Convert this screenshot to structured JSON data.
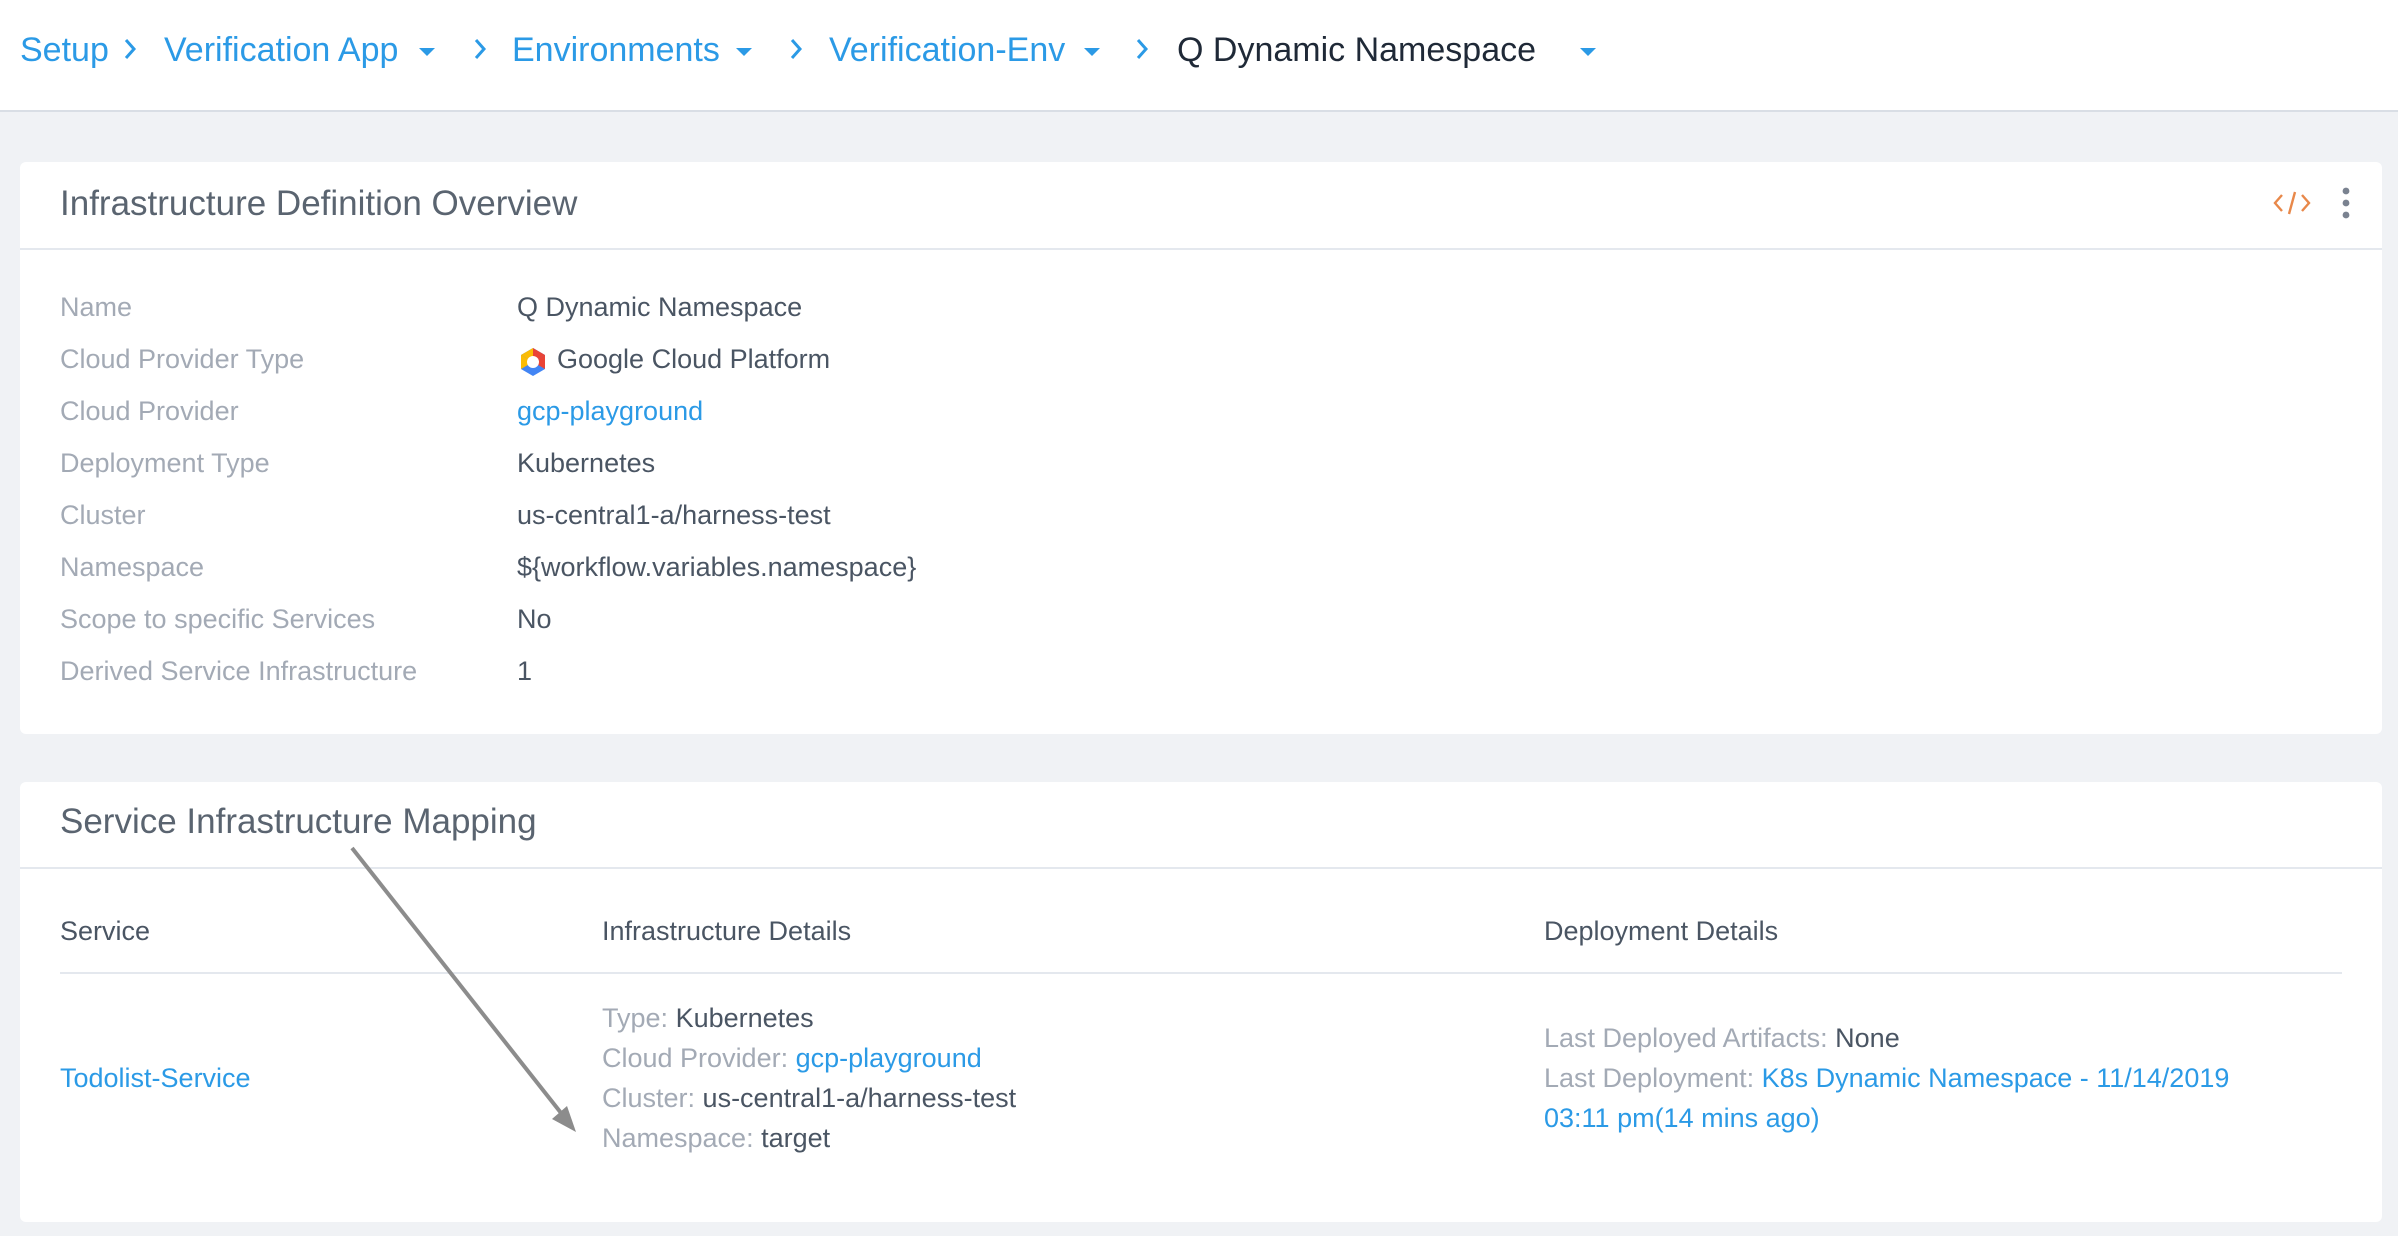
{
  "breadcrumb": [
    {
      "label": "Setup",
      "has_dropdown": false
    },
    {
      "label": "Verification App",
      "has_dropdown": true
    },
    {
      "label": "Environments",
      "has_dropdown": true
    },
    {
      "label": "Verification-Env",
      "has_dropdown": true
    },
    {
      "label": "Q Dynamic Namespace",
      "has_dropdown": true,
      "current": true
    }
  ],
  "overview": {
    "title": "Infrastructure Definition Overview",
    "icons": [
      "code-icon",
      "more-vertical-icon"
    ],
    "fields": [
      {
        "label": "Name",
        "value": "Q Dynamic Namespace"
      },
      {
        "label": "Cloud Provider Type",
        "value": "Google Cloud Platform",
        "icon": "gcp-logo-icon"
      },
      {
        "label": "Cloud Provider",
        "value": "gcp-playground",
        "link": true
      },
      {
        "label": "Deployment Type",
        "value": "Kubernetes"
      },
      {
        "label": "Cluster",
        "value": "us-central1-a/harness-test"
      },
      {
        "label": "Namespace",
        "value": "${workflow.variables.namespace}"
      },
      {
        "label": "Scope to specific Services",
        "value": "No"
      },
      {
        "label": "Derived Service Infrastructure",
        "value": "1"
      }
    ]
  },
  "mapping": {
    "title": "Service Infrastructure Mapping",
    "columns": [
      "Service",
      "Infrastructure Details",
      "Deployment Details"
    ],
    "rows": [
      {
        "service": "Todolist-Service",
        "infra": {
          "type_label": "Type:",
          "type_value": "Kubernetes",
          "provider_label": "Cloud Provider:",
          "provider_value": "gcp-playground",
          "cluster_label": "Cluster:",
          "cluster_value": "us-central1-a/harness-test",
          "namespace_label": "Namespace:",
          "namespace_value": "target"
        },
        "deployment": {
          "artifacts_label": "Last Deployed Artifacts:",
          "artifacts_value": "None",
          "last_label": "Last Deployment:",
          "last_value_line1": "K8s Dynamic Namespace - 11/14/2019",
          "last_value_line2": "03:11 pm(14 mins ago)"
        }
      }
    ]
  },
  "colors": {
    "link": "#2b9ae6",
    "muted": "#a3aab5",
    "text": "#4a5563",
    "accent": "#e8884a",
    "arrow": "#8c8c8c"
  }
}
